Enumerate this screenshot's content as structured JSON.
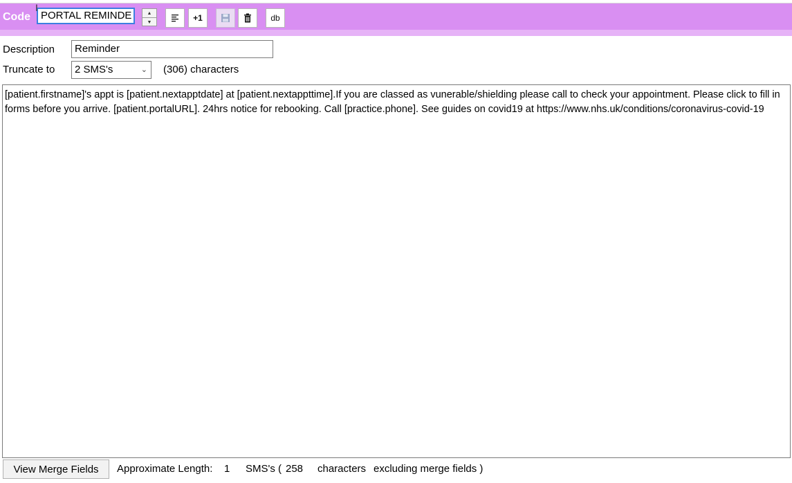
{
  "toolbar": {
    "code_label": "Code",
    "code_value": "PORTAL REMINDE",
    "align_icon": "align-left-icon",
    "plus_one_label": "+1",
    "save_icon": "save-icon",
    "delete_icon": "trash-icon",
    "db_label": "db",
    "accent_color": "#d98ff2"
  },
  "form": {
    "description_label": "Description",
    "description_value": "Reminder",
    "truncate_label": "Truncate to",
    "truncate_value": "2 SMS's",
    "char_count": "(306) characters"
  },
  "message": {
    "text": "[patient.firstname]'s appt is [patient.nextapptdate] at [patient.nextappttime].If you are classed as vunerable/shielding please call to check your appointment. Please click to fill in forms before you arrive. [patient.portalURL]. 24hrs notice for rebooking. Call [practice.phone]. See guides on covid19 at https://www.nhs.uk/conditions/coronavirus-covid-19"
  },
  "footer": {
    "merge_button": "View Merge Fields",
    "approx_label": "Approximate Length:",
    "approx_value": "1",
    "sms_label": "SMS's (",
    "sms_chars": "258",
    "chars_label": "characters",
    "excluding_label": "excluding merge fields )"
  }
}
